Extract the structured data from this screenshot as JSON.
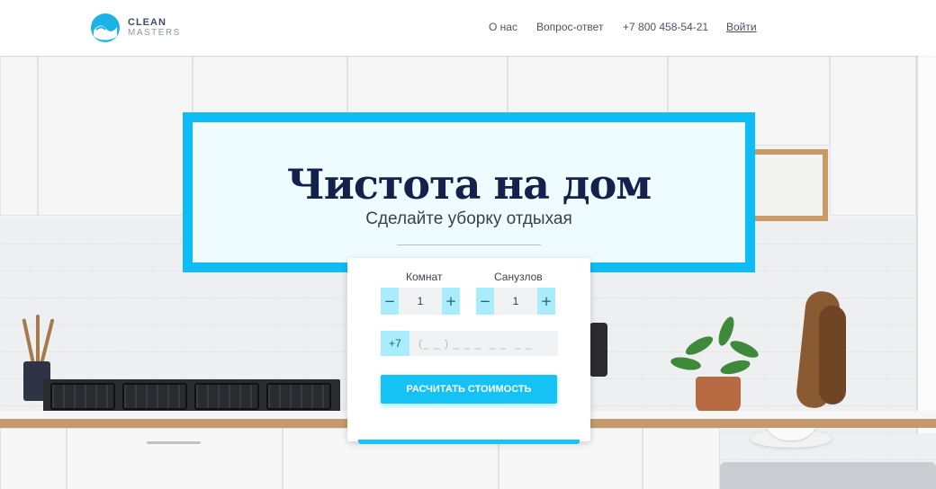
{
  "header": {
    "logo": {
      "line1": "CLEAN",
      "line2": "MASTERS"
    },
    "nav": {
      "about": "О нас",
      "faq": "Вопрос-ответ",
      "phone": "+7 800 458-54-21",
      "login": "Войти"
    }
  },
  "hero": {
    "title": "Чистота на дом",
    "subtitle": "Сделайте уборку отдыхая"
  },
  "calculator": {
    "rooms": {
      "label": "Комнат",
      "value": "1",
      "minus": "−",
      "plus": "+"
    },
    "bathrooms": {
      "label": "Санузлов",
      "value": "1",
      "minus": "−",
      "plus": "+"
    },
    "phone": {
      "code": "+7",
      "placeholder": "(_ _ ) _ _ _  _ _  _ _"
    },
    "submit": "РАСЧИТАТЬ СТОИМОСТЬ"
  },
  "colors": {
    "accent": "#0ebdf5",
    "title": "#14214d",
    "stepper": "#a9ecfb"
  }
}
